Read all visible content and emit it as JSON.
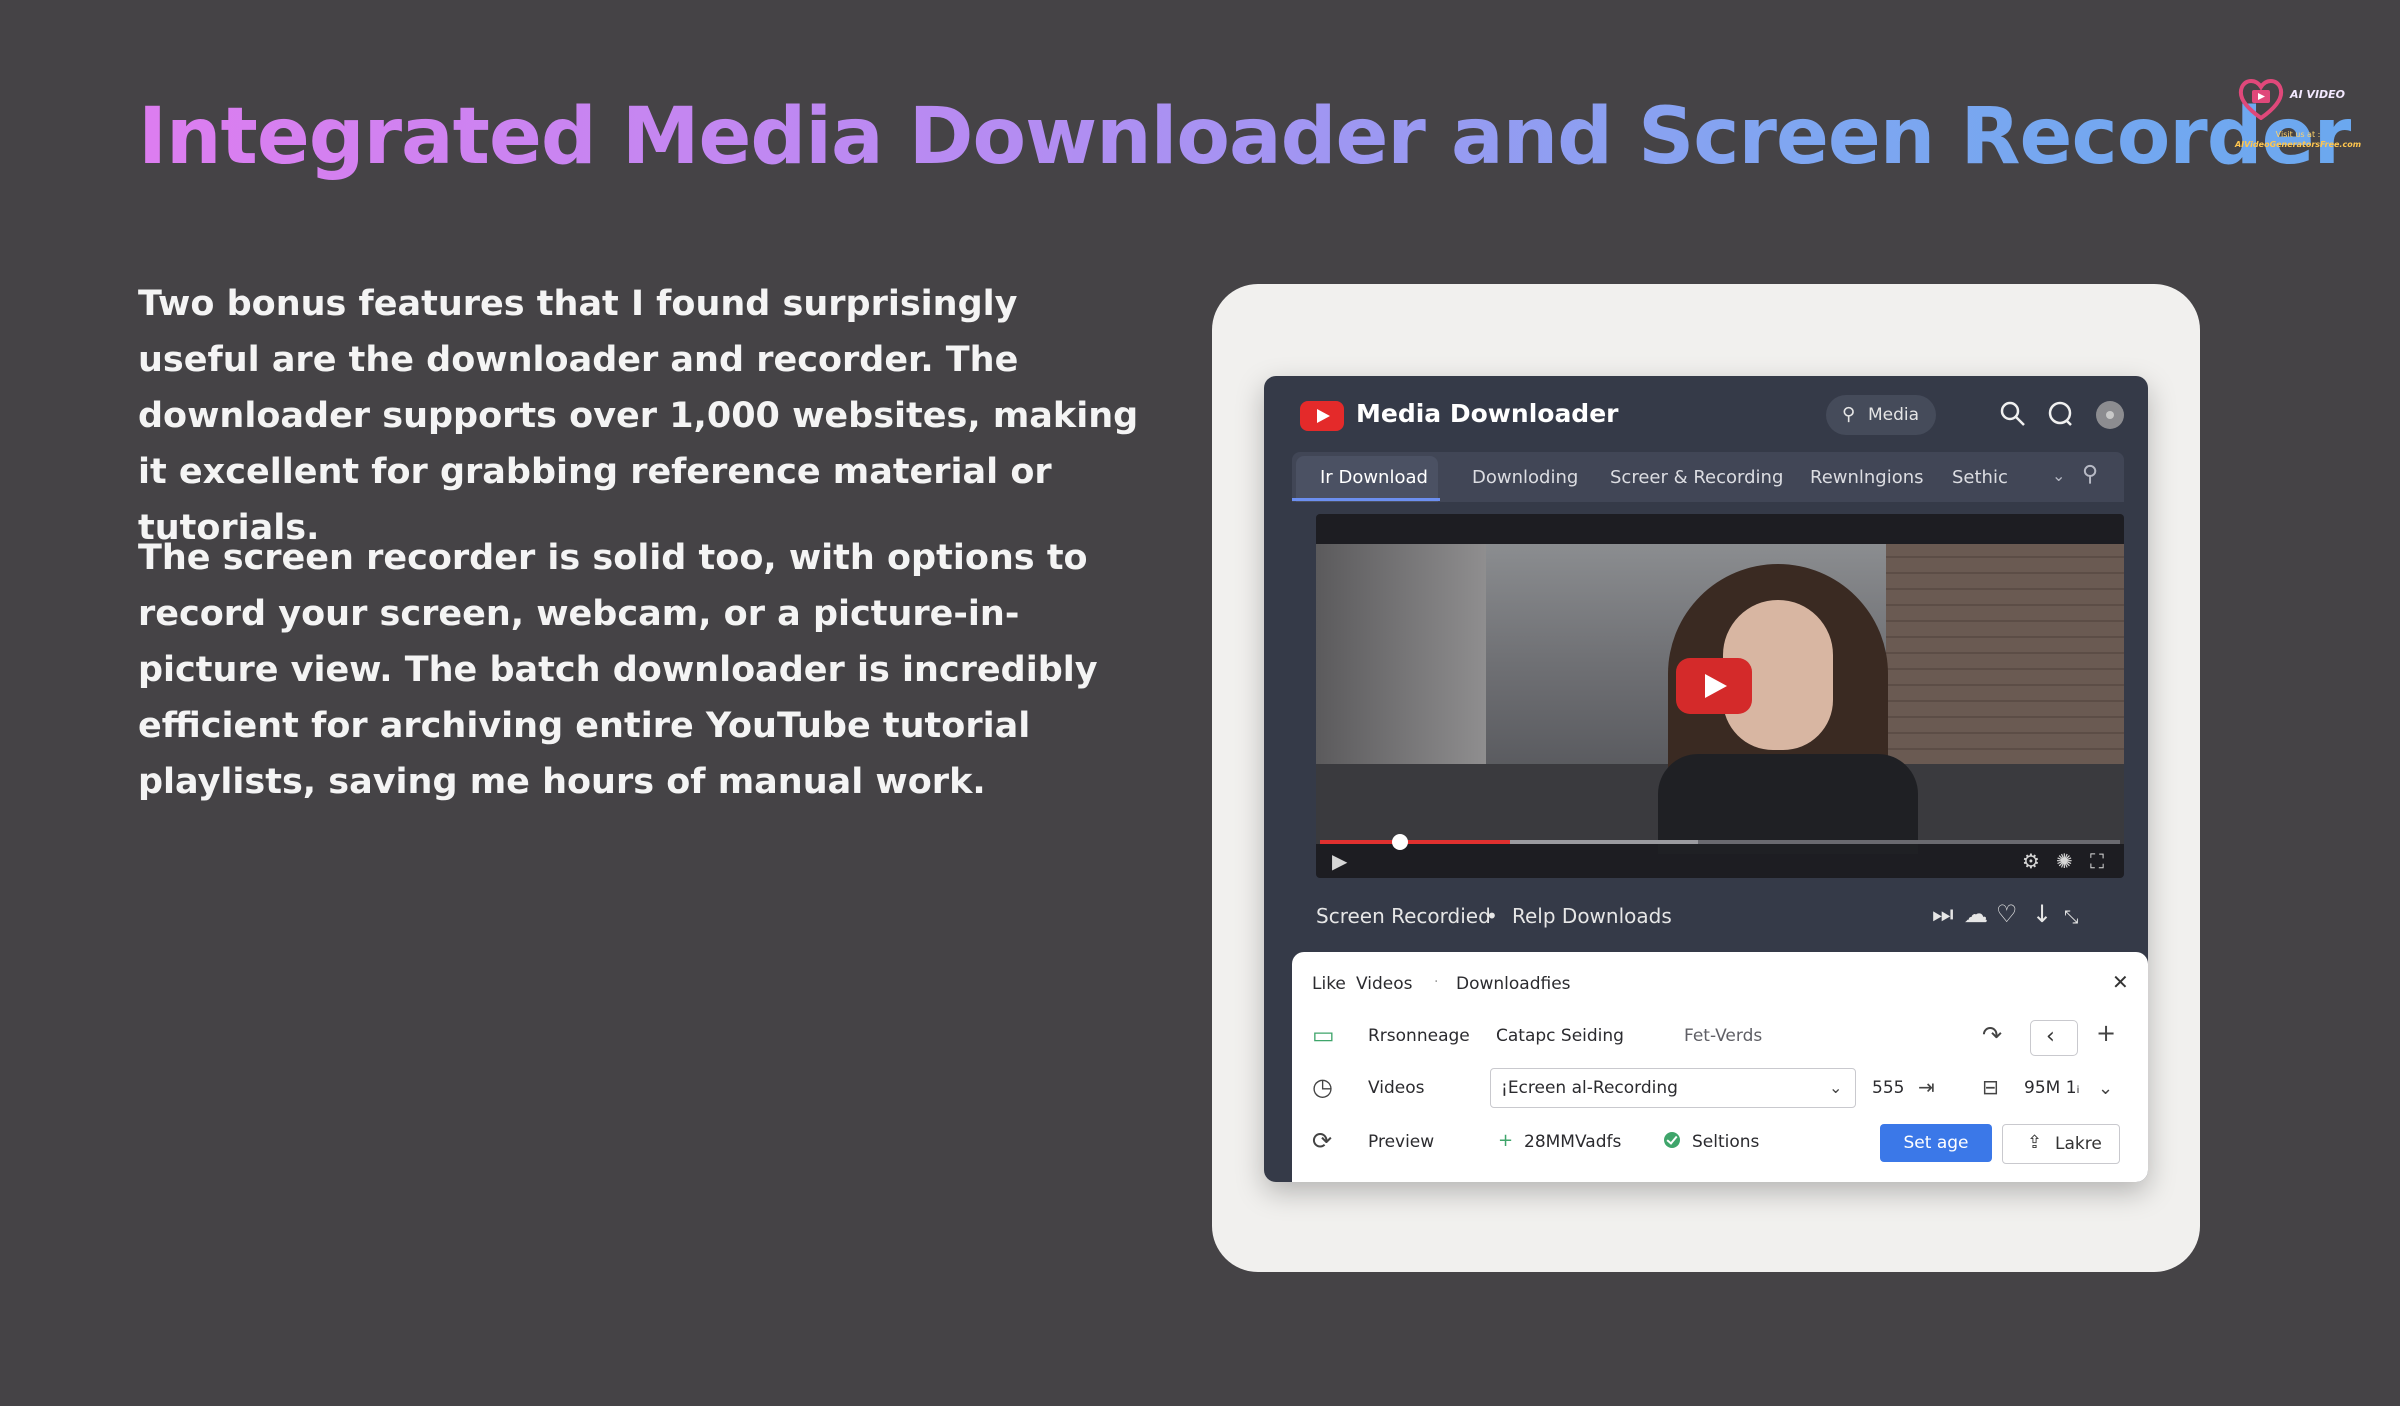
{
  "heading": "Integrated Media Downloader and Screen Recorder",
  "logo": {
    "brand": "AI VIDEO",
    "visit": "Visit us at :",
    "url": "AIVideoGeneratorsFree.com"
  },
  "paragraphs": [
    "Two bonus features that I found surprisingly useful are the downloader and recorder. The downloader supports over 1,000 websites, making it excellent for grabbing reference material or tutorials.",
    "The screen recorder is solid too, with options to record your screen, webcam, or a picture-in-picture view. The batch downloader is incredibly efficient for archiving entire YouTube tutorial playlists, saving me hours of manual work."
  ],
  "app": {
    "title": "Media Downloader",
    "search_pill": "Media",
    "tabs": [
      {
        "label": "Download",
        "prefix": "Ir",
        "active": true
      },
      {
        "label": "Downloding",
        "active": false
      },
      {
        "label": "Screer & Recording",
        "active": false
      },
      {
        "label": "Rewnlngions",
        "active": false
      },
      {
        "label": "Sethic",
        "active": false
      }
    ],
    "video": {
      "progress": 0.1
    },
    "status": {
      "left": "Screen Recordied",
      "bullet": "•",
      "right": "Relp Downloads"
    },
    "panel": {
      "breadcrumb": [
        "Like",
        "Videos",
        "Downloadfies"
      ],
      "breadcrumb_sep": "·",
      "row1": {
        "label": "Rrsonneage",
        "col2": "Catapc Seiding",
        "col3": "Fet-Verds"
      },
      "row2": {
        "label": "Videos",
        "select_value": "¡Ecreen al-Recording",
        "count": "555",
        "size": "95M 1ᵢ"
      },
      "row3": {
        "label": "Preview",
        "col2": "28MMVadfs",
        "status": "Seltions"
      },
      "primary_button": "Set age",
      "secondary_button": "Lakre"
    }
  },
  "colors": {
    "background": "#454346",
    "app_bg": "#353a48",
    "accent_blue": "#3b78e8",
    "yt_red": "#e42a2a",
    "success_green": "#3fa56b"
  },
  "icons": [
    "youtube-logo-icon",
    "search-icon",
    "chat-icon",
    "avatar",
    "play-icon",
    "settings-icon",
    "fullscreen-icon",
    "skip-icon",
    "cloud-icon",
    "heart-icon",
    "download-arrow-icon",
    "expand-icon",
    "close-icon",
    "image-icon",
    "clock-icon",
    "refresh-icon",
    "share-icon",
    "back-icon",
    "plus-icon",
    "monitor-icon",
    "chevron-down-icon",
    "export-icon"
  ]
}
